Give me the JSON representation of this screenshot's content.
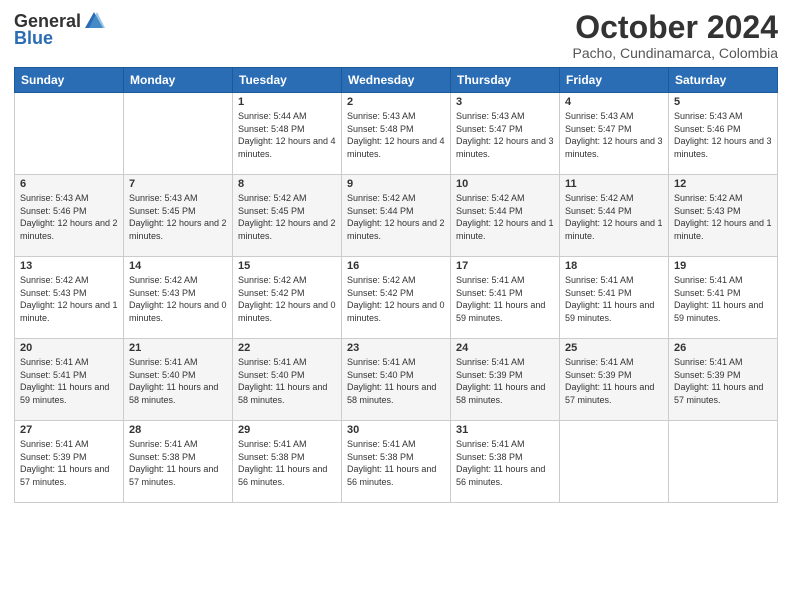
{
  "logo": {
    "general": "General",
    "blue": "Blue"
  },
  "title": "October 2024",
  "location": "Pacho, Cundinamarca, Colombia",
  "days": [
    "Sunday",
    "Monday",
    "Tuesday",
    "Wednesday",
    "Thursday",
    "Friday",
    "Saturday"
  ],
  "weeks": [
    [
      {
        "day": "",
        "sunrise": "",
        "sunset": "",
        "daylight": ""
      },
      {
        "day": "",
        "sunrise": "",
        "sunset": "",
        "daylight": ""
      },
      {
        "day": "1",
        "sunrise": "Sunrise: 5:44 AM",
        "sunset": "Sunset: 5:48 PM",
        "daylight": "Daylight: 12 hours and 4 minutes."
      },
      {
        "day": "2",
        "sunrise": "Sunrise: 5:43 AM",
        "sunset": "Sunset: 5:48 PM",
        "daylight": "Daylight: 12 hours and 4 minutes."
      },
      {
        "day": "3",
        "sunrise": "Sunrise: 5:43 AM",
        "sunset": "Sunset: 5:47 PM",
        "daylight": "Daylight: 12 hours and 3 minutes."
      },
      {
        "day": "4",
        "sunrise": "Sunrise: 5:43 AM",
        "sunset": "Sunset: 5:47 PM",
        "daylight": "Daylight: 12 hours and 3 minutes."
      },
      {
        "day": "5",
        "sunrise": "Sunrise: 5:43 AM",
        "sunset": "Sunset: 5:46 PM",
        "daylight": "Daylight: 12 hours and 3 minutes."
      }
    ],
    [
      {
        "day": "6",
        "sunrise": "Sunrise: 5:43 AM",
        "sunset": "Sunset: 5:46 PM",
        "daylight": "Daylight: 12 hours and 2 minutes."
      },
      {
        "day": "7",
        "sunrise": "Sunrise: 5:43 AM",
        "sunset": "Sunset: 5:45 PM",
        "daylight": "Daylight: 12 hours and 2 minutes."
      },
      {
        "day": "8",
        "sunrise": "Sunrise: 5:42 AM",
        "sunset": "Sunset: 5:45 PM",
        "daylight": "Daylight: 12 hours and 2 minutes."
      },
      {
        "day": "9",
        "sunrise": "Sunrise: 5:42 AM",
        "sunset": "Sunset: 5:44 PM",
        "daylight": "Daylight: 12 hours and 2 minutes."
      },
      {
        "day": "10",
        "sunrise": "Sunrise: 5:42 AM",
        "sunset": "Sunset: 5:44 PM",
        "daylight": "Daylight: 12 hours and 1 minute."
      },
      {
        "day": "11",
        "sunrise": "Sunrise: 5:42 AM",
        "sunset": "Sunset: 5:44 PM",
        "daylight": "Daylight: 12 hours and 1 minute."
      },
      {
        "day": "12",
        "sunrise": "Sunrise: 5:42 AM",
        "sunset": "Sunset: 5:43 PM",
        "daylight": "Daylight: 12 hours and 1 minute."
      }
    ],
    [
      {
        "day": "13",
        "sunrise": "Sunrise: 5:42 AM",
        "sunset": "Sunset: 5:43 PM",
        "daylight": "Daylight: 12 hours and 1 minute."
      },
      {
        "day": "14",
        "sunrise": "Sunrise: 5:42 AM",
        "sunset": "Sunset: 5:43 PM",
        "daylight": "Daylight: 12 hours and 0 minutes."
      },
      {
        "day": "15",
        "sunrise": "Sunrise: 5:42 AM",
        "sunset": "Sunset: 5:42 PM",
        "daylight": "Daylight: 12 hours and 0 minutes."
      },
      {
        "day": "16",
        "sunrise": "Sunrise: 5:42 AM",
        "sunset": "Sunset: 5:42 PM",
        "daylight": "Daylight: 12 hours and 0 minutes."
      },
      {
        "day": "17",
        "sunrise": "Sunrise: 5:41 AM",
        "sunset": "Sunset: 5:41 PM",
        "daylight": "Daylight: 11 hours and 59 minutes."
      },
      {
        "day": "18",
        "sunrise": "Sunrise: 5:41 AM",
        "sunset": "Sunset: 5:41 PM",
        "daylight": "Daylight: 11 hours and 59 minutes."
      },
      {
        "day": "19",
        "sunrise": "Sunrise: 5:41 AM",
        "sunset": "Sunset: 5:41 PM",
        "daylight": "Daylight: 11 hours and 59 minutes."
      }
    ],
    [
      {
        "day": "20",
        "sunrise": "Sunrise: 5:41 AM",
        "sunset": "Sunset: 5:41 PM",
        "daylight": "Daylight: 11 hours and 59 minutes."
      },
      {
        "day": "21",
        "sunrise": "Sunrise: 5:41 AM",
        "sunset": "Sunset: 5:40 PM",
        "daylight": "Daylight: 11 hours and 58 minutes."
      },
      {
        "day": "22",
        "sunrise": "Sunrise: 5:41 AM",
        "sunset": "Sunset: 5:40 PM",
        "daylight": "Daylight: 11 hours and 58 minutes."
      },
      {
        "day": "23",
        "sunrise": "Sunrise: 5:41 AM",
        "sunset": "Sunset: 5:40 PM",
        "daylight": "Daylight: 11 hours and 58 minutes."
      },
      {
        "day": "24",
        "sunrise": "Sunrise: 5:41 AM",
        "sunset": "Sunset: 5:39 PM",
        "daylight": "Daylight: 11 hours and 58 minutes."
      },
      {
        "day": "25",
        "sunrise": "Sunrise: 5:41 AM",
        "sunset": "Sunset: 5:39 PM",
        "daylight": "Daylight: 11 hours and 57 minutes."
      },
      {
        "day": "26",
        "sunrise": "Sunrise: 5:41 AM",
        "sunset": "Sunset: 5:39 PM",
        "daylight": "Daylight: 11 hours and 57 minutes."
      }
    ],
    [
      {
        "day": "27",
        "sunrise": "Sunrise: 5:41 AM",
        "sunset": "Sunset: 5:39 PM",
        "daylight": "Daylight: 11 hours and 57 minutes."
      },
      {
        "day": "28",
        "sunrise": "Sunrise: 5:41 AM",
        "sunset": "Sunset: 5:38 PM",
        "daylight": "Daylight: 11 hours and 57 minutes."
      },
      {
        "day": "29",
        "sunrise": "Sunrise: 5:41 AM",
        "sunset": "Sunset: 5:38 PM",
        "daylight": "Daylight: 11 hours and 56 minutes."
      },
      {
        "day": "30",
        "sunrise": "Sunrise: 5:41 AM",
        "sunset": "Sunset: 5:38 PM",
        "daylight": "Daylight: 11 hours and 56 minutes."
      },
      {
        "day": "31",
        "sunrise": "Sunrise: 5:41 AM",
        "sunset": "Sunset: 5:38 PM",
        "daylight": "Daylight: 11 hours and 56 minutes."
      },
      {
        "day": "",
        "sunrise": "",
        "sunset": "",
        "daylight": ""
      },
      {
        "day": "",
        "sunrise": "",
        "sunset": "",
        "daylight": ""
      }
    ]
  ]
}
